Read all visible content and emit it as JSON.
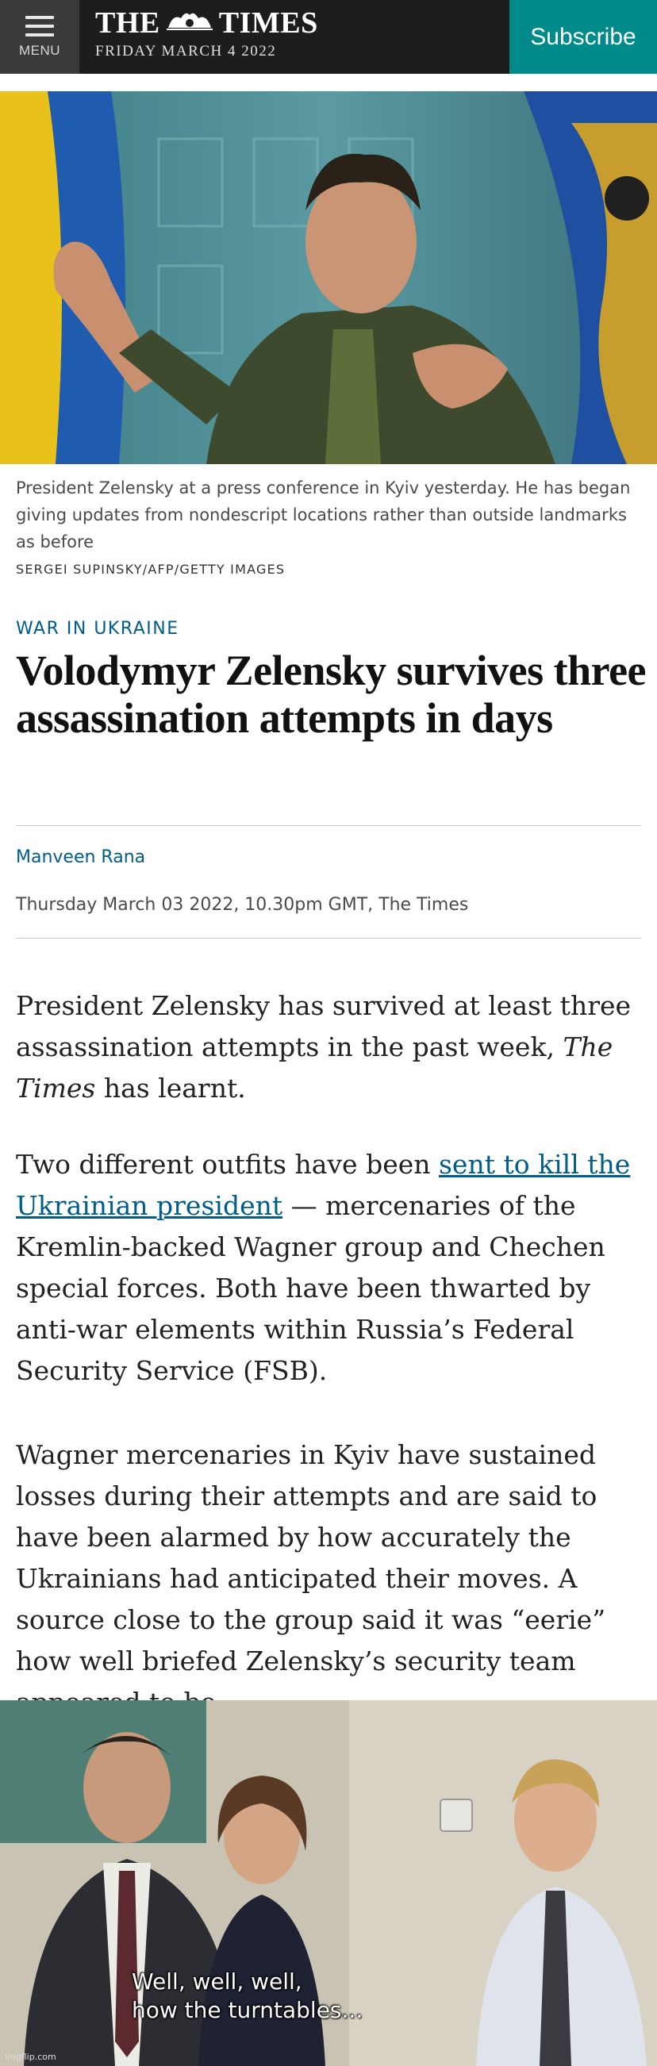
{
  "header": {
    "menu_label": "MENU",
    "logo_left": "THE",
    "logo_right": "TIMES",
    "dateline": "FRIDAY MARCH 4 2022",
    "subscribe_label": "Subscribe",
    "colors": {
      "bar": "#1d1d1b",
      "subscribe": "#008a8a"
    }
  },
  "hero": {
    "caption": "President Zelensky at a press conference in Kyiv yesterday. He has began giving updates from nondescript locations rather than outside landmarks as before",
    "credit": "SERGEI SUPINSKY/AFP/GETTY IMAGES"
  },
  "article": {
    "section": "WAR IN UKRAINE",
    "headline": "Volodymyr Zelensky survives three assassination attempts in days",
    "author": "Manveen Rana",
    "published": "Thursday March 03 2022, 10.30pm GMT, The Times",
    "p1_before": "President Zelensky has survived at least three assassination attempts in the past week, ",
    "p1_em": "The Times",
    "p1_after": " has learnt.",
    "p2_before": "Two different outfits have been ",
    "p2_link": "sent to kill the Ukrainian president",
    "p2_after": " — mercenaries of the Kremlin-backed Wagner group and Chechen special forces. Both have been thwarted by anti-war elements within Russia’s Federal Security Service (FSB).",
    "p3": "Wagner mercenaries in Kyiv have sustained losses during their attempts and are said to have been alarmed by how accurately the Ukrainians had anticipated their moves. A source close to the group said it was “eerie” how well briefed Zelensky’s security team appeared to be."
  },
  "meme": {
    "line1": "Well, well, well,",
    "line2": "how the turntables...",
    "watermark": "imgflip.com"
  }
}
